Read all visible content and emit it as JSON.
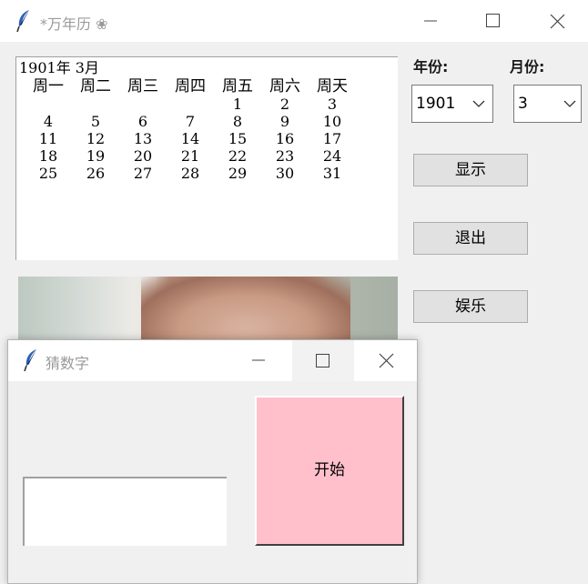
{
  "main_window": {
    "title": "*万年历 ❀",
    "calendar": {
      "heading": "1901年  3月",
      "weekdays": [
        "周一",
        "周二",
        "周三",
        "周四",
        "周五",
        "周六",
        "周天"
      ],
      "weeks": [
        [
          "",
          "",
          "",
          "",
          "1",
          "2",
          "3"
        ],
        [
          "4",
          "5",
          "6",
          "7",
          "8",
          "9",
          "10"
        ],
        [
          "11",
          "12",
          "13",
          "14",
          "15",
          "16",
          "17"
        ],
        [
          "18",
          "19",
          "20",
          "21",
          "22",
          "23",
          "24"
        ],
        [
          "25",
          "26",
          "27",
          "28",
          "29",
          "30",
          "31"
        ]
      ]
    },
    "year_label": "年份:",
    "month_label": "月份:",
    "year_value": "1901",
    "month_value": "3",
    "buttons": {
      "show": "显示",
      "exit": "退出",
      "fun": "娱乐"
    }
  },
  "popup_window": {
    "title": "猜数字",
    "entry_value": "",
    "start_label": "开始",
    "start_color": "#ffc0cb"
  },
  "icons": [
    "feather-icon",
    "minimize-icon",
    "maximize-icon",
    "close-icon",
    "chevron-down-icon"
  ]
}
